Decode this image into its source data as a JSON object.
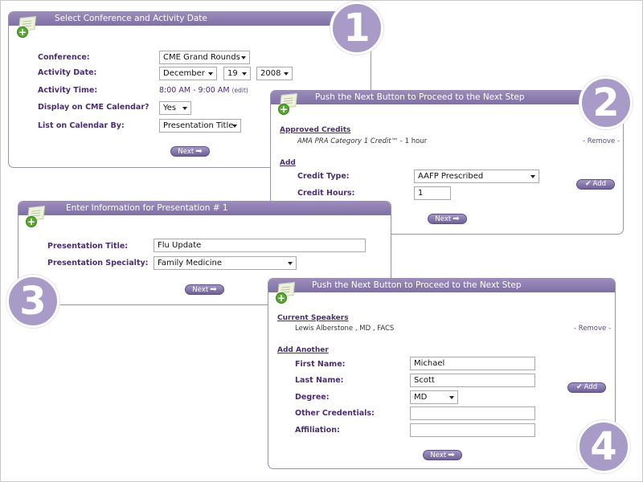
{
  "panel1": {
    "title": "Select Conference and Activity Date",
    "badge": "1",
    "conference_label": "Conference:",
    "conference_value": "CME Grand Rounds",
    "date_label": "Activity Date:",
    "month_value": "December",
    "day_value": "19",
    "year_value": "2008",
    "time_label": "Activity Time:",
    "time_value": "8:00 AM - 9:00 AM",
    "edit_link": "(edit)",
    "display_label": "Display on CME Calendar?",
    "display_value": "Yes",
    "list_label": "List on Calendar By:",
    "list_value": "Presentation Title",
    "next_label": "Next"
  },
  "panel2": {
    "title": "Push the Next Button to Proceed to the Next Step",
    "badge": "2",
    "approved_heading": "Approved Credits",
    "credit_name": "AMA PRA Category 1 Credit™",
    "credit_amount": " - 1 hour",
    "remove_link": "- Remove -",
    "add_heading": "Add",
    "credit_type_label": "Credit Type:",
    "credit_type_value": "AAFP Prescribed",
    "credit_hours_label": "Credit Hours:",
    "credit_hours_value": "1",
    "add_label": "Add",
    "next_label": "Next"
  },
  "panel3": {
    "title": "Enter Information for Presentation # 1",
    "badge": "3",
    "pres_title_label": "Presentation Title:",
    "pres_title_value": "Flu Update",
    "specialty_label": "Presentation Specialty:",
    "specialty_value": "Family Medicine",
    "next_label": "Next"
  },
  "panel4": {
    "title": "Push the Next Button to Proceed to the Next Step",
    "badge": "4",
    "speakers_heading": "Current Speakers",
    "speaker_value": "Lewis  Alberstone , MD , FACS",
    "remove_link": "- Remove -",
    "add_another_heading": "Add Another",
    "first_name_label": "First Name:",
    "first_name_value": "Michael",
    "last_name_label": "Last Name:",
    "last_name_value": "Scott",
    "degree_label": "Degree:",
    "degree_value": "MD",
    "other_label": "Other Credentials:",
    "other_value": "",
    "affiliation_label": "Affiliation:",
    "affiliation_value": "",
    "add_label": "Add",
    "next_label": "Next"
  }
}
